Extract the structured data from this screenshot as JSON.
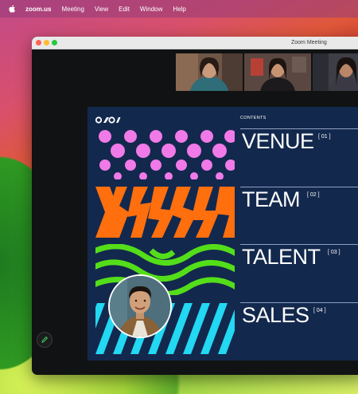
{
  "menubar": {
    "apple_icon": "apple-logo-icon",
    "items": [
      {
        "label": "zoom.us",
        "bold": true
      },
      {
        "label": "Meeting"
      },
      {
        "label": "View"
      },
      {
        "label": "Edit"
      },
      {
        "label": "Window"
      },
      {
        "label": "Help"
      }
    ]
  },
  "window": {
    "title": "Zoom Meeting"
  },
  "participants": [
    {
      "id": "participant-1",
      "icon": "participant-video"
    },
    {
      "id": "participant-2",
      "icon": "participant-video"
    },
    {
      "id": "participant-3",
      "icon": "participant-video"
    }
  ],
  "slide": {
    "logo_icon": "brand-logo-icon",
    "contents_label": "CONTENTS",
    "sections": [
      {
        "title": "VENUE",
        "number": "[ 01 ]",
        "pattern": "pink-dots",
        "color": "#f07ae8"
      },
      {
        "title": "TEAM",
        "number": "[ 02 ]",
        "pattern": "orange-chevrons",
        "color": "#ff6f0e"
      },
      {
        "title": "TALENT",
        "number": "[ 03 ]",
        "pattern": "green-waves",
        "color": "#54de1a"
      },
      {
        "title": "SALES",
        "number": "[ 04 ]",
        "pattern": "cyan-stripes",
        "color": "#22d8f2"
      }
    ],
    "background_color": "#13284d"
  },
  "self_view": {
    "icon": "self-video"
  },
  "annotate_button": {
    "icon": "pencil-icon"
  }
}
